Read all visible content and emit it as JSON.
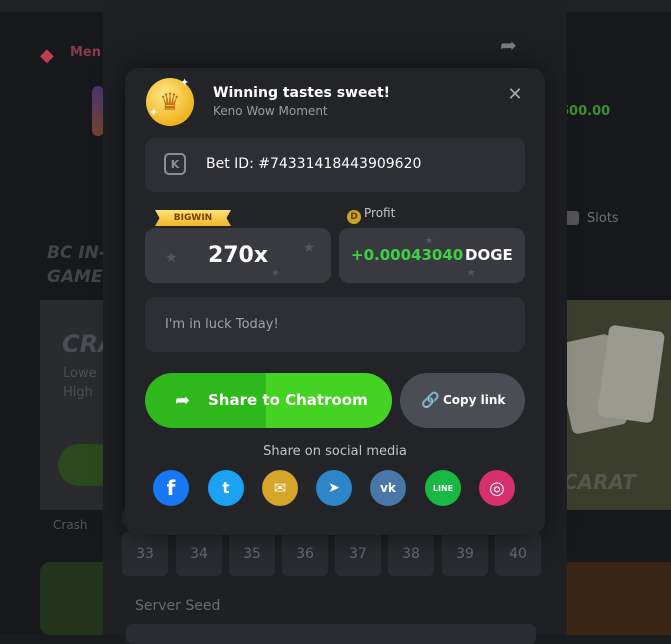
{
  "background": {
    "menu_text": "Men",
    "amount_text": "600.00",
    "slots_label": "Slots",
    "bc_in_line1": "BC IN-",
    "bc_in_line2": "GAMES",
    "banner_left_title": "CRA",
    "banner_left_line1": "Lowe",
    "banner_left_line2": "High",
    "crash_label": "Crash",
    "banner_right_title": "CARAT",
    "number_tiles": [
      "33",
      "34",
      "35",
      "36",
      "37",
      "38",
      "39",
      "40"
    ],
    "server_seed_label": "Server Seed"
  },
  "modal": {
    "title": "Winning tastes sweet!",
    "subtitle": "Keno Wow Moment",
    "close_icon": "close-icon",
    "bet_id": "Bet ID: #74331418443909620",
    "badge": "BIGWIN",
    "multiplier": "270x",
    "profit_label": "Profit",
    "coin_symbol": "D",
    "profit_value": "+0.00043040",
    "profit_currency": "DOGE",
    "comment_placeholder": "I'm in luck Today!",
    "share_button": "Share to Chatroom",
    "copy_button": "Copy link",
    "social_title": "Share on social media",
    "social": [
      {
        "name": "facebook",
        "icon": "facebook-icon",
        "color": "#1877f2",
        "glyph": "f"
      },
      {
        "name": "twitter",
        "icon": "twitter-icon",
        "color": "#1da1f2",
        "glyph": "t"
      },
      {
        "name": "email",
        "icon": "email-icon",
        "color": "#d3a528",
        "glyph": "✉"
      },
      {
        "name": "telegram",
        "icon": "telegram-icon",
        "color": "#2e85c7",
        "glyph": "➤"
      },
      {
        "name": "vk",
        "icon": "vk-icon",
        "color": "#4a76a8",
        "glyph": "vk"
      },
      {
        "name": "line",
        "icon": "line-icon",
        "color": "#19b844",
        "glyph": "LINE"
      },
      {
        "name": "instagram",
        "icon": "instagram-icon",
        "color": "#d6306d",
        "glyph": "◎"
      }
    ]
  }
}
